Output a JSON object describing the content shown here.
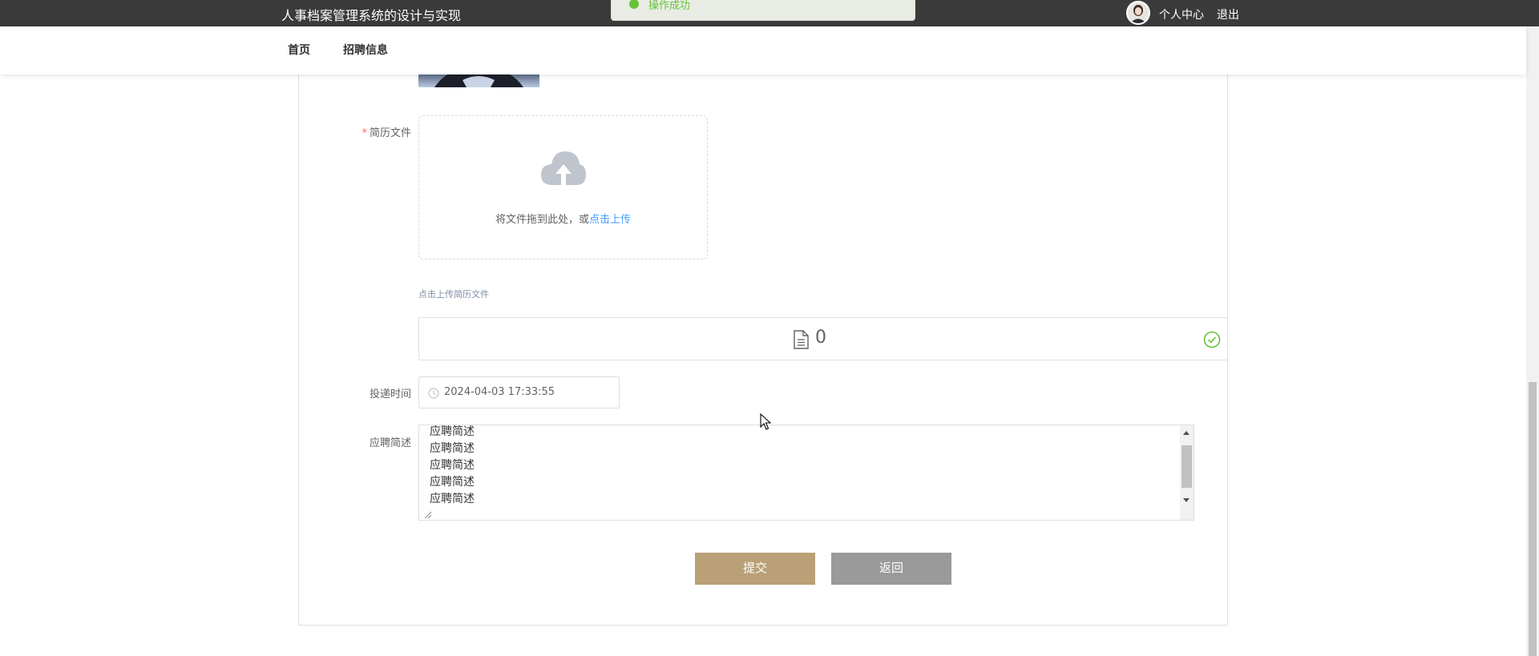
{
  "topbar": {
    "app_title": "人事档案管理系统的设计与实现",
    "toast": "操作成功",
    "profile_link": "个人中心",
    "logout_link": "退出"
  },
  "nav": {
    "items": [
      {
        "label": "首页"
      },
      {
        "label": "招聘信息"
      }
    ]
  },
  "form": {
    "resume_label": "简历文件",
    "upload_text": "将文件拖到此处，或",
    "upload_link": "点击上传",
    "upload_hint": "点击上传简历文件",
    "file_count": "0",
    "time_label": "投递时间",
    "time_value": "2024-04-03 17:33:55",
    "desc_label": "应聘简述",
    "desc_lines": [
      "应聘简述",
      "应聘简述",
      "应聘简述",
      "应聘简述",
      "应聘简述"
    ],
    "submit_label": "提交",
    "back_label": "返回"
  },
  "colors": {
    "topbar": "#3a3a3a",
    "submit": "#b9a076",
    "back": "#9a9a9a",
    "link": "#409eff",
    "required": "#f56c6c",
    "success": "#67c23a"
  }
}
